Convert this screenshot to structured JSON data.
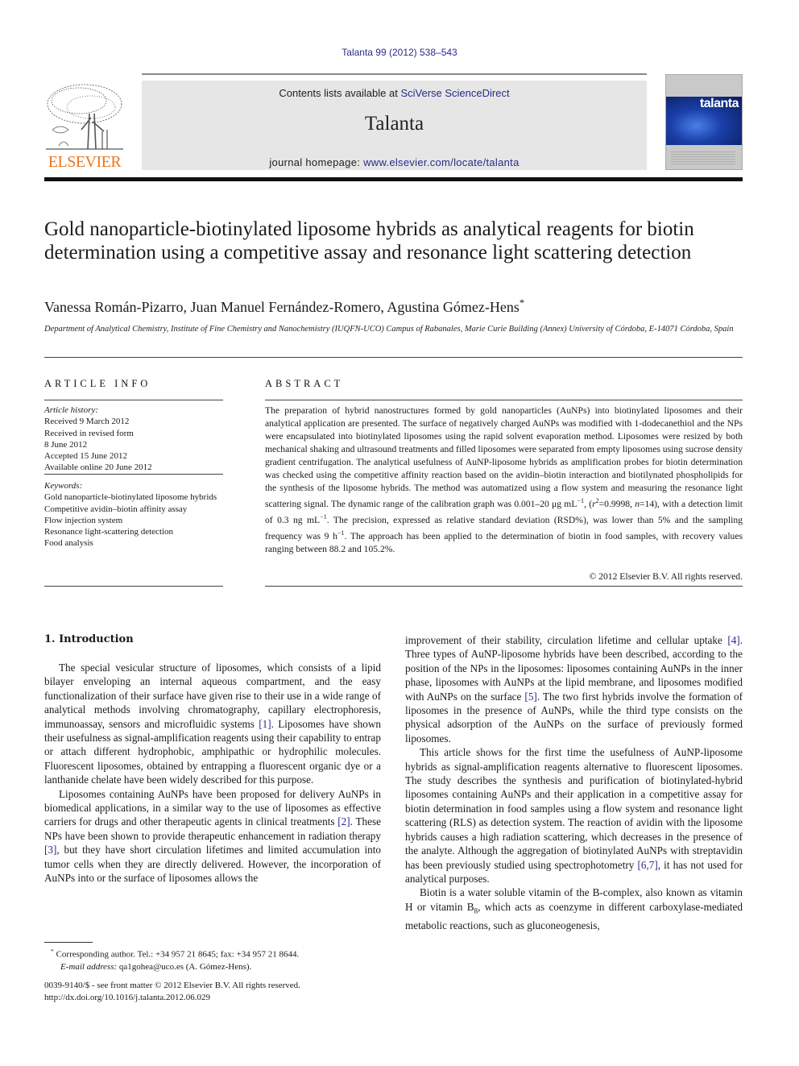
{
  "header": {
    "citation": "Talanta 99 (2012) 538–543",
    "contents_prefix": "Contents lists available at ",
    "contents_link": "SciVerse ScienceDirect",
    "journal_title": "Talanta",
    "homepage_prefix": "journal homepage: ",
    "homepage_link": "www.elsevier.com/locate/talanta",
    "publisher_logo_text": "ELSEVIER",
    "cover_title": "talanta",
    "publisher_color": "#e87722",
    "link_color": "#2a2a8c"
  },
  "article": {
    "title": "Gold nanoparticle-biotinylated liposome hybrids as analytical reagents for biotin determination using a competitive assay and resonance light scattering detection",
    "authors": "Vanessa Román-Pizarro, Juan Manuel Fernández-Romero, Agustina Gómez-Hens",
    "corresponding_mark": "*",
    "affiliation": "Department of Analytical Chemistry, Institute of Fine Chemistry and Nanochemistry (IUQFN-UCO) Campus of Rabanales, Marie Curie Building (Annex) University of Córdoba, E-14071 Córdoba, Spain"
  },
  "article_info": {
    "heading": "ARTICLE INFO",
    "history_label": "Article history:",
    "history": [
      "Received 9 March 2012",
      "Received in revised form",
      "8 June 2012",
      "Accepted 15 June 2012",
      "Available online 20 June 2012"
    ],
    "keywords_label": "Keywords:",
    "keywords": [
      "Gold nanoparticle-biotinylated liposome hybrids",
      "Competitive avidin–biotin affinity assay",
      "Flow injection system",
      "Resonance light-scattering detection",
      "Food analysis"
    ]
  },
  "abstract": {
    "heading": "ABSTRACT",
    "text_1": "The preparation of hybrid nanostructures formed by gold nanoparticles (AuNPs) into biotinylated liposomes and their analytical application are presented. The surface of negatively charged AuNPs was modified with 1-dodecanethiol and the NPs were encapsulated into biotinylated liposomes using the rapid solvent evaporation method. Liposomes were resized by both mechanical shaking and ultrasound treatments and filled liposomes were separated from empty liposomes using sucrose density gradient centrifugation. The analytical usefulness of AuNP-liposome hybrids as amplification probes for biotin determination was checked using the competitive affinity reaction based on the avidin–biotin interaction and biotilynated phospholipids for the synthesis of the liposome hybrids. The method was automatized using a flow system and measuring the resonance light scattering signal. The dynamic range of the calibration graph was 0.001–20 μg mL",
    "exp_neg1": "−1",
    "text_2": ", (",
    "r_sym": "r",
    "sq": "2",
    "text_3": "=0.9998, ",
    "n_sym": "n",
    "text_4": "=14), with a detection limit of 0.3 ng mL",
    "text_5": ". The precision, expressed as relative standard deviation (RSD%), was lower than 5% and the sampling frequency was 9 h",
    "text_6": ". The approach has been applied to the determination of biotin in food samples, with recovery values ranging between 88.2 and 105.2%.",
    "copyright": "© 2012 Elsevier B.V. All rights reserved."
  },
  "intro": {
    "heading": "1.  Introduction",
    "p1_a": "The special vesicular structure of liposomes, which consists of a lipid bilayer enveloping an internal aqueous compartment, and the easy functionalization of their surface have given rise to their use in a wide range of analytical methods involving chromatography, capillary electrophoresis, immunoassay, sensors and microfluidic systems ",
    "ref1": "[1]",
    "p1_b": ". Liposomes have shown their usefulness as signal-amplification reagents using their capability to entrap or attach different hydrophobic, amphipathic or hydrophilic molecules. Fluorescent liposomes, obtained by entrapping a fluorescent organic dye or a lanthanide chelate have been widely described for this purpose.",
    "p2_a": "Liposomes containing AuNPs have been proposed for delivery AuNPs in biomedical applications, in a similar way to the use of liposomes as effective carriers for drugs and other therapeutic agents in clinical treatments ",
    "ref2": "[2]",
    "p2_b": ". These NPs have been shown to provide therapeutic enhancement in radiation therapy ",
    "ref3": "[3]",
    "p2_c": ", but they have short circulation lifetimes and limited accumulation into tumor cells when they are directly delivered. However, the incorporation of AuNPs into or the surface of liposomes allows the improvement of their stability, circulation lifetime and cellular uptake ",
    "ref4": "[4]",
    "p2_d": ". Three types of AuNP-liposome hybrids have been described, according to the position of the NPs in the liposomes: liposomes containing AuNPs in the inner phase, liposomes with AuNPs at the lipid membrane, and liposomes modified with AuNPs on the surface ",
    "ref5": "[5]",
    "p2_e": ". The two first hybrids involve the formation of liposomes in the presence of AuNPs, while the third type consists on the physical adsorption of the AuNPs on the surface of previously formed liposomes.",
    "p3_a": "This article shows for the first time the usefulness of AuNP-liposome hybrids as signal-amplification reagents alternative to fluorescent liposomes. The study describes the synthesis and purification of biotinylated-hybrid liposomes containing AuNPs and their application in a competitive assay for biotin determination in food samples using a flow system and resonance light scattering (RLS) as detection system. The reaction of avidin with the liposome hybrids causes a high radiation scattering, which decreases in the presence of the analyte. Although the aggregation of biotinylated AuNPs with streptavidin has been previously studied using spectrophotometry ",
    "ref67": "[6,7]",
    "p3_b": ", it has not used for analytical purposes.",
    "p4_a": "Biotin is a water soluble vitamin of the B-complex, also known as vitamin H or vitamin B",
    "p4_sub": "8",
    "p4_b": ", which acts as coenzyme in different carboxylase-mediated metabolic reactions, such as gluconeogenesis,"
  },
  "footnote": {
    "mark": "*",
    "corresponding": " Corresponding author. Tel.: +34 957 21 8645; fax: +34 957 21 8644.",
    "email_label": "E-mail address:",
    "email": " qa1gohea@uco.es (A. Gómez-Hens)."
  },
  "front_matter": {
    "issn_line": "0039-9140/$ - see front matter © 2012 Elsevier B.V. All rights reserved.",
    "doi": "http://dx.doi.org/10.1016/j.talanta.2012.06.029"
  }
}
